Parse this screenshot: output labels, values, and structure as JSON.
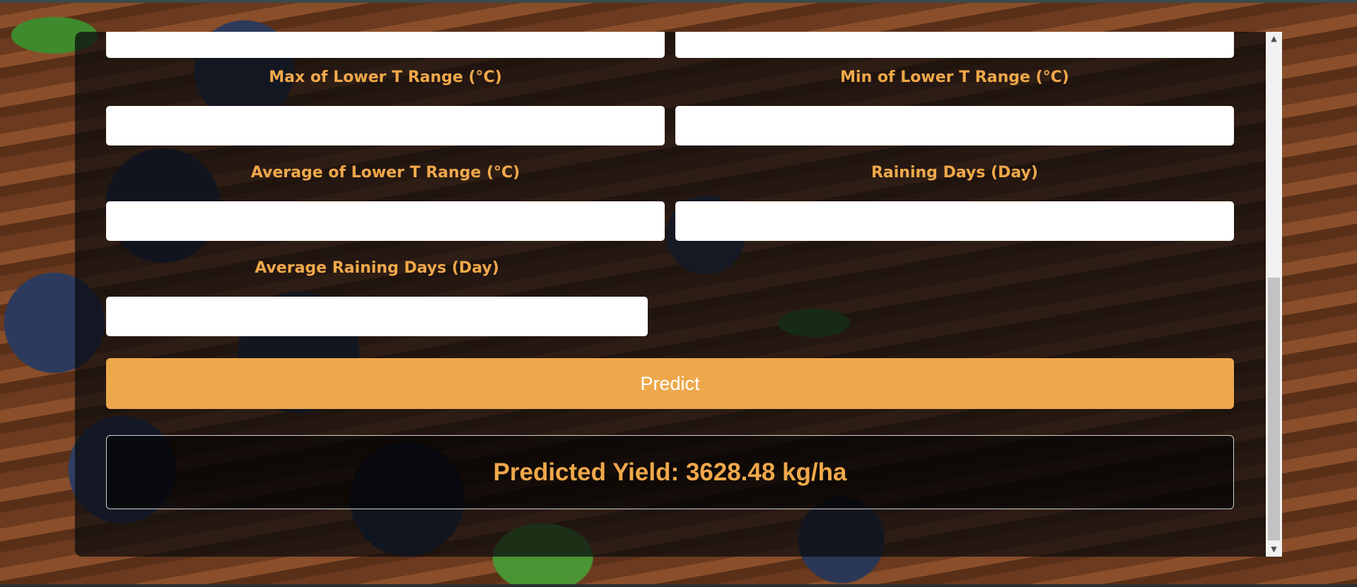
{
  "form": {
    "fields": [
      {
        "label": "Max of Lower T Range (°C)",
        "value": "",
        "placeholder": ""
      },
      {
        "label": "Min of Lower T Range (°C)",
        "value": "",
        "placeholder": ""
      },
      {
        "label": "Average of Lower T Range (°C)",
        "value": "",
        "placeholder": ""
      },
      {
        "label": "Raining Days (Day)",
        "value": "",
        "placeholder": ""
      },
      {
        "label": "Average Raining Days (Day)",
        "value": "",
        "placeholder": ""
      }
    ],
    "predict_label": "Predict"
  },
  "result": {
    "text": "Predicted Yield: 3628.48 kg/ha"
  },
  "colors": {
    "accent": "#eea84c",
    "label": "#f0a84a"
  },
  "scrollbar": {
    "up_icon": "scroll-up-arrow-icon",
    "down_icon": "scroll-down-arrow-icon"
  }
}
